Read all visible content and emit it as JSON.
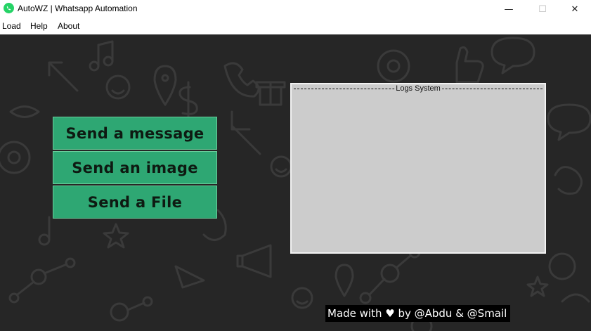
{
  "window": {
    "title": "AutoWZ | Whatsapp Automation",
    "minimize_glyph": "—",
    "maximize_glyph": "☐",
    "close_glyph": "✕"
  },
  "menu": {
    "items": [
      {
        "label": "Load"
      },
      {
        "label": "Help"
      },
      {
        "label": "About"
      }
    ]
  },
  "actions": {
    "send_message": "Send a message",
    "send_image": "Send an image",
    "send_file": "Send a File"
  },
  "logs": {
    "title": "Logs System"
  },
  "footer": {
    "text": "Made with ♥ by @Abdu & @Smail"
  },
  "colors": {
    "background": "#262626",
    "button": "#2ea773",
    "logs_panel": "#cccccc",
    "app_icon": "#25d366"
  },
  "icons": {
    "app": "whatsapp-icon",
    "background": "doodle-pattern"
  }
}
